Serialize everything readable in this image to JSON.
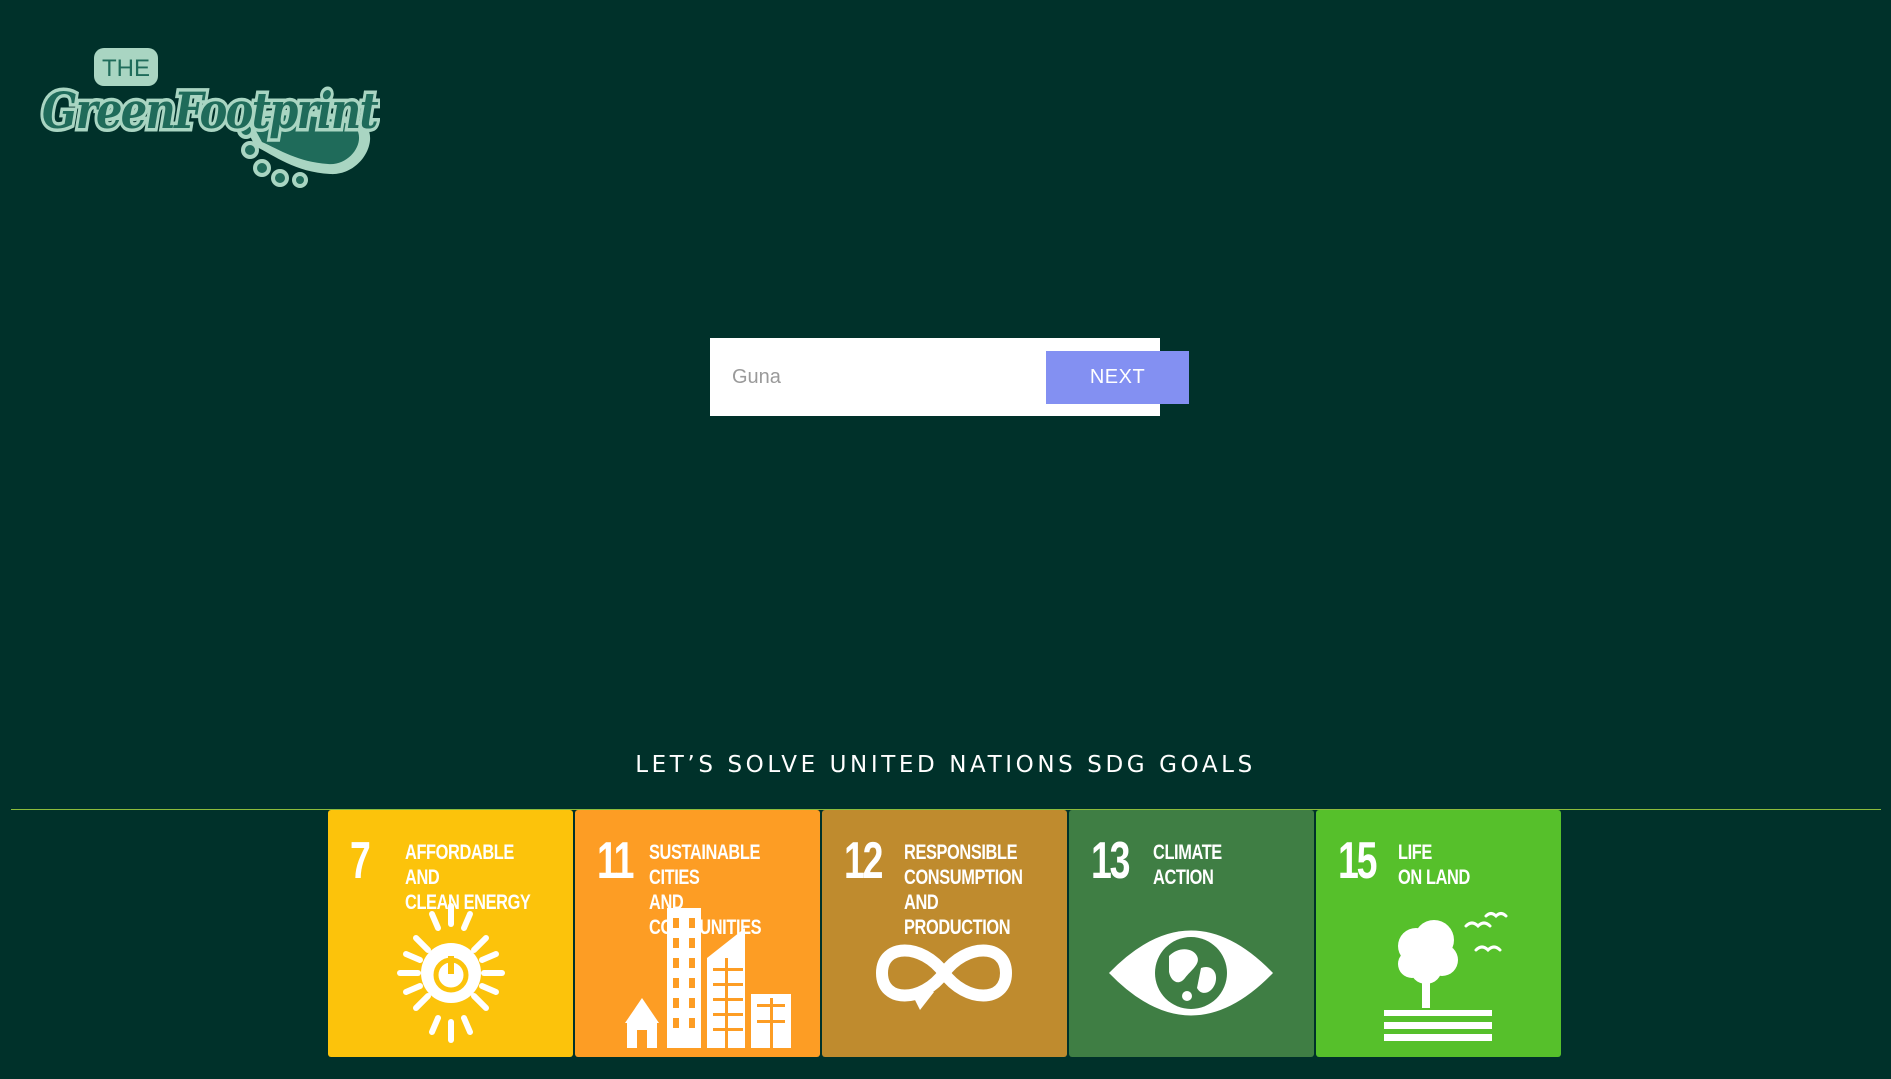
{
  "brand": {
    "logo_top": "THE",
    "logo_main": "GreenFootprint",
    "logo_icon": "footprint-icon"
  },
  "entry": {
    "name_value": "",
    "name_placeholder": "Guna",
    "next_label": "NEXT"
  },
  "tagline": "LET’S SOLVE UNITED NATIONS SDG GOALS",
  "colors": {
    "background": "#00312a",
    "next_button": "#8390f2",
    "divider": "#8cbc3c"
  },
  "goals": [
    {
      "number": "7",
      "title": "AFFORDABLE AND\nCLEAN ENERGY",
      "icon": "sun-power-icon",
      "color": "#fcc30b"
    },
    {
      "number": "11",
      "title": "SUSTAINABLE CITIES\nAND COMMUNITIES",
      "icon": "city-buildings-icon",
      "color": "#fd9d24"
    },
    {
      "number": "12",
      "title": "RESPONSIBLE\nCONSUMPTION\nAND PRODUCTION",
      "icon": "infinity-loop-icon",
      "color": "#bf8b2e"
    },
    {
      "number": "13",
      "title": "CLIMATE\nACTION",
      "icon": "earth-eye-icon",
      "color": "#3f7e44"
    },
    {
      "number": "15",
      "title": "LIFE\nON LAND",
      "icon": "tree-birds-icon",
      "color": "#56c02b"
    }
  ]
}
